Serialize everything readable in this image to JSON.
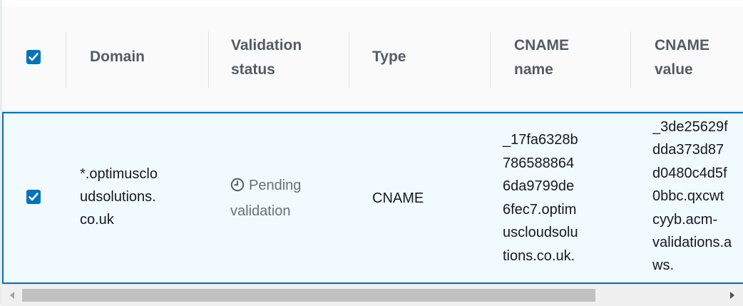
{
  "columns": [
    {
      "key": "select",
      "label": ""
    },
    {
      "key": "domain",
      "label": "Domain"
    },
    {
      "key": "validation_status",
      "label": "Validation status"
    },
    {
      "key": "type",
      "label": "Type"
    },
    {
      "key": "cname_name",
      "label": "CNAME name"
    },
    {
      "key": "cname_value",
      "label": "CNAME value"
    }
  ],
  "header_checkbox_checked": true,
  "rows": [
    {
      "selected": true,
      "domain": [
        "*.optimusclo",
        "udsolutions.",
        "co.uk"
      ],
      "status_line1": "Pending",
      "status_line2": "validation",
      "status_icon": "clock-icon",
      "type": "CNAME",
      "cname_name": [
        "_17fa6328b",
        "786588864",
        "6da9799de",
        "6fec7.optim",
        "uscloudsolu",
        "tions.co.uk."
      ],
      "cname_value": [
        "_3de25629f",
        "dda373d87",
        "d0480c4d5f",
        "0bbc.qxcwt",
        "cyyb.acm-",
        "validations.a",
        "ws."
      ]
    }
  ],
  "colors": {
    "accent": "#0073bb",
    "header_bg": "#fafafa",
    "selected_row_bg": "#f1faff",
    "muted_text": "#687078"
  }
}
